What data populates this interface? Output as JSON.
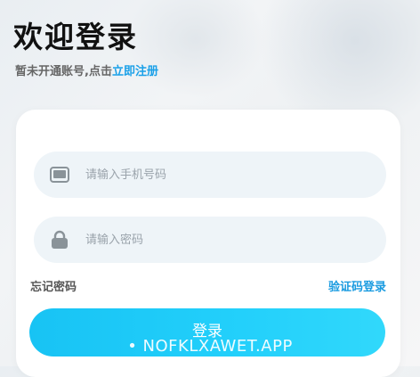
{
  "header": {
    "title": "欢迎登录",
    "subtitle_prefix": "暂未开通账号,点击",
    "register_link": "立即注册"
  },
  "form": {
    "phone_placeholder": "请输入手机号码",
    "password_placeholder": "请输入密码",
    "forgot_password": "忘记密码",
    "sms_login": "验证码登录",
    "login_button": "登录"
  },
  "watermark": "• NOFKLXAWET.APP",
  "icons": {
    "phone_field": "tablet-icon",
    "password_field": "lock-icon"
  },
  "colors": {
    "accent": "#1aa0e8",
    "button_gradient_start": "#18c3f4",
    "button_gradient_end": "#31d8fb",
    "icon_gray": "#8a9399"
  }
}
